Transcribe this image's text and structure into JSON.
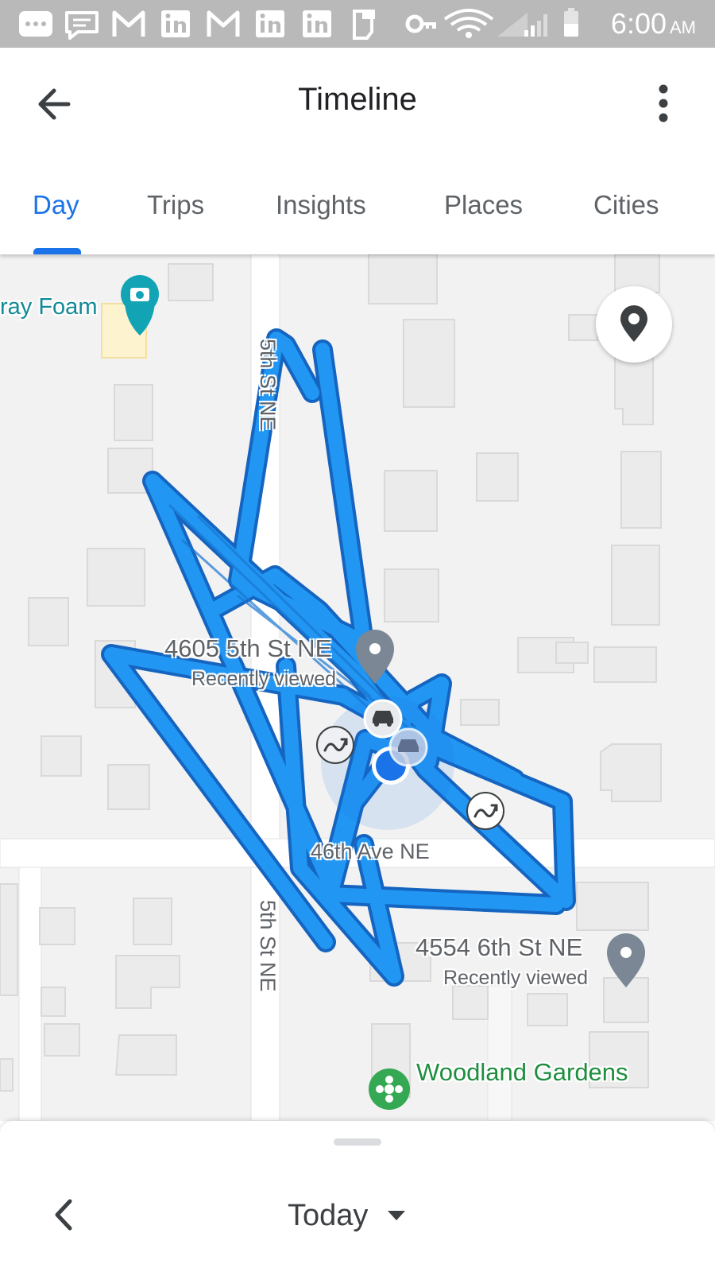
{
  "status_bar": {
    "time": "6:00",
    "ampm": "AM",
    "icons": [
      "more-notifications-icon",
      "chat-icon",
      "gmail-icon",
      "linkedin-icon",
      "gmail-icon",
      "linkedin-icon",
      "linkedin-icon",
      "id-icon",
      "key-icon",
      "wifi-icon",
      "no-signal-icon",
      "signal-icon",
      "battery-icon"
    ]
  },
  "app_bar": {
    "title": "Timeline"
  },
  "tabs": [
    {
      "label": "Day",
      "active": true
    },
    {
      "label": "Trips",
      "active": false
    },
    {
      "label": "Insights",
      "active": false
    },
    {
      "label": "Places",
      "active": false
    },
    {
      "label": "Cities",
      "active": false
    }
  ],
  "map": {
    "poi_label": "ray Foam",
    "places": [
      {
        "address": "4605 5th St NE",
        "note": "Recently viewed"
      },
      {
        "address": "4554 6th St NE",
        "note": "Recently viewed"
      }
    ],
    "streets": {
      "vertical_top": "5th St NE",
      "vertical_bottom": "5th St NE",
      "horizontal": "46th Ave NE"
    },
    "park_label": "Woodland Gardens",
    "route_color": "#2196f3",
    "route_outline_color": "#1565c0",
    "current_location_color": "#1a73e8"
  },
  "bottom_sheet": {
    "date_label": "Today"
  },
  "colors": {
    "accent": "#1a73e8",
    "text_primary": "#202124",
    "text_secondary": "#5f6368",
    "status_bar": "#b9b9b9"
  }
}
